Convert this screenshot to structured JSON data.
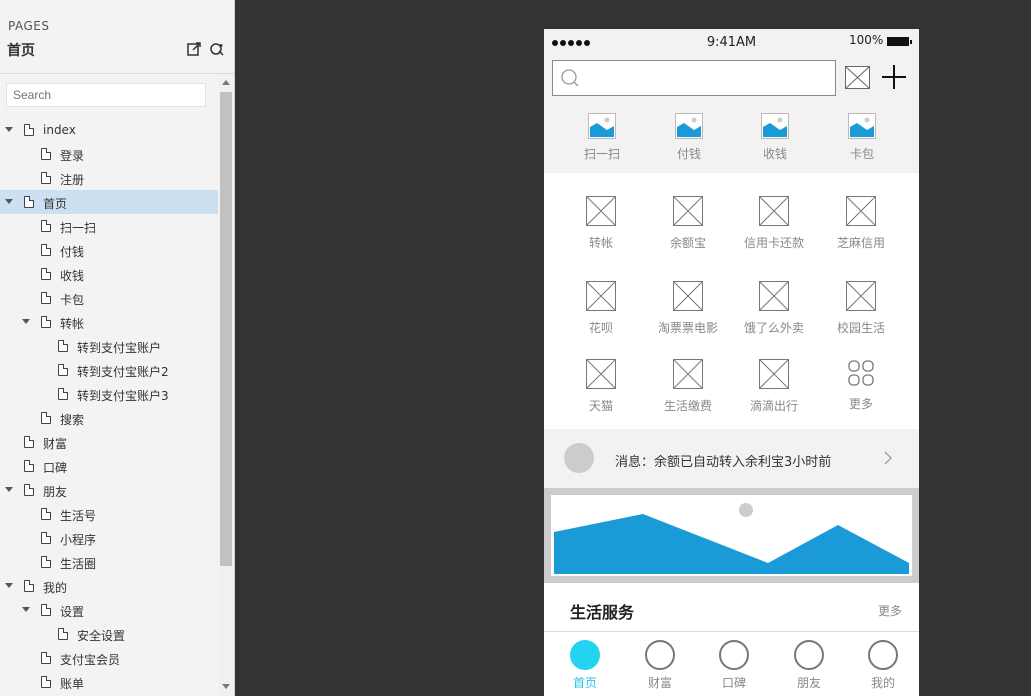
{
  "pages_panel": {
    "header_label": "PAGES",
    "current_page": "首页",
    "search_placeholder": "Search",
    "tree": [
      {
        "label": "index",
        "level": 0,
        "expanded": true
      },
      {
        "label": "登录",
        "level": 1
      },
      {
        "label": "注册",
        "level": 1
      },
      {
        "label": "首页",
        "level": 0,
        "expanded": true,
        "selected": true
      },
      {
        "label": "扫一扫",
        "level": 1
      },
      {
        "label": "付钱",
        "level": 1
      },
      {
        "label": "收钱",
        "level": 1
      },
      {
        "label": "卡包",
        "level": 1
      },
      {
        "label": "转帐",
        "level": 1,
        "expanded": true
      },
      {
        "label": "转到支付宝账户",
        "level": 2
      },
      {
        "label": "转到支付宝账户2",
        "level": 2
      },
      {
        "label": "转到支付宝账户3",
        "level": 2
      },
      {
        "label": "搜索",
        "level": 1
      },
      {
        "label": "财富",
        "level": 0
      },
      {
        "label": "口碑",
        "level": 0
      },
      {
        "label": "朋友",
        "level": 0,
        "expanded": true
      },
      {
        "label": "生活号",
        "level": 1
      },
      {
        "label": "小程序",
        "level": 1
      },
      {
        "label": "生活圈",
        "level": 1
      },
      {
        "label": "我的",
        "level": 0,
        "expanded": true
      },
      {
        "label": "设置",
        "level": 1,
        "expanded": true
      },
      {
        "label": "安全设置",
        "level": 2
      },
      {
        "label": "支付宝会员",
        "level": 1
      },
      {
        "label": "账单",
        "level": 1
      }
    ]
  },
  "phone": {
    "status": {
      "time": "9:41AM",
      "battery": "100%"
    },
    "quick_actions": [
      "扫一扫",
      "付钱",
      "收钱",
      "卡包"
    ],
    "grid": [
      [
        "转帐",
        "余额宝",
        "信用卡还款",
        "芝麻信用"
      ],
      [
        "花呗",
        "淘票票电影",
        "饿了么外卖",
        "校园生活"
      ],
      [
        "天猫",
        "生活缴费",
        "滴滴出行",
        "更多"
      ]
    ],
    "message": "消息：余额已自动转入余利宝3小时前",
    "section": {
      "title": "生活服务",
      "more": "更多"
    },
    "tabs": [
      {
        "label": "首页",
        "active": true
      },
      {
        "label": "财富"
      },
      {
        "label": "口碑"
      },
      {
        "label": "朋友"
      },
      {
        "label": "我的"
      }
    ]
  },
  "colors": {
    "accent": "#24d3f0",
    "banner_blue": "#1a9bd7",
    "selected_row": "#cde0f2",
    "canvas_bg": "#333333"
  }
}
